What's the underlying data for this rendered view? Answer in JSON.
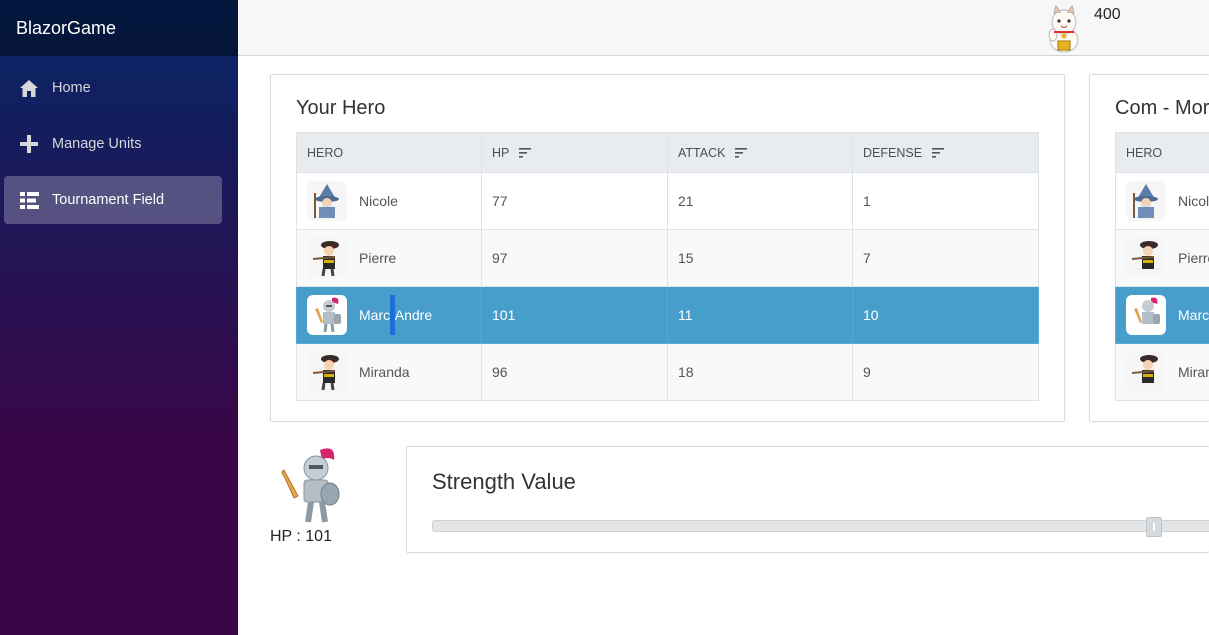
{
  "app": {
    "brand": "BlazorGame"
  },
  "nav": [
    {
      "label": "Home",
      "icon": "home-icon"
    },
    {
      "label": "Manage Units",
      "icon": "plus-icon"
    },
    {
      "label": "Tournament Field",
      "icon": "list-icon",
      "active": true
    }
  ],
  "topbar": {
    "coins": "400",
    "icon": "lucky-cat-icon"
  },
  "your_hero": {
    "title": "Your Hero",
    "columns": [
      "HERO",
      "HP",
      "ATTACK",
      "DEFENSE"
    ],
    "rows": [
      {
        "name": "Nicole",
        "hp": "77",
        "attack": "21",
        "defense": "1",
        "avatar": "wizard-avatar"
      },
      {
        "name": "Pierre",
        "hp": "97",
        "attack": "15",
        "defense": "7",
        "avatar": "archer-avatar"
      },
      {
        "name": "Marc-Andre",
        "hp": "101",
        "attack": "11",
        "defense": "10",
        "avatar": "knight-avatar",
        "selected": true
      },
      {
        "name": "Miranda",
        "hp": "96",
        "attack": "18",
        "defense": "9",
        "avatar": "archer-avatar"
      }
    ]
  },
  "com_hero": {
    "title": "Com - Mor",
    "columns": [
      "HERO"
    ],
    "rows": [
      {
        "name": "Nicol"
      },
      {
        "name": "Pierre"
      },
      {
        "name": "Marc",
        "selected": true
      },
      {
        "name": "Miran"
      }
    ]
  },
  "fighter": {
    "hp_text": "HP : 101"
  },
  "strength": {
    "title": "Strength Value",
    "value_fraction": 0.915
  },
  "colors": {
    "selected_row": "#479ecb",
    "sidebar_top": "#052767",
    "sidebar_bottom": "#3a0647"
  }
}
